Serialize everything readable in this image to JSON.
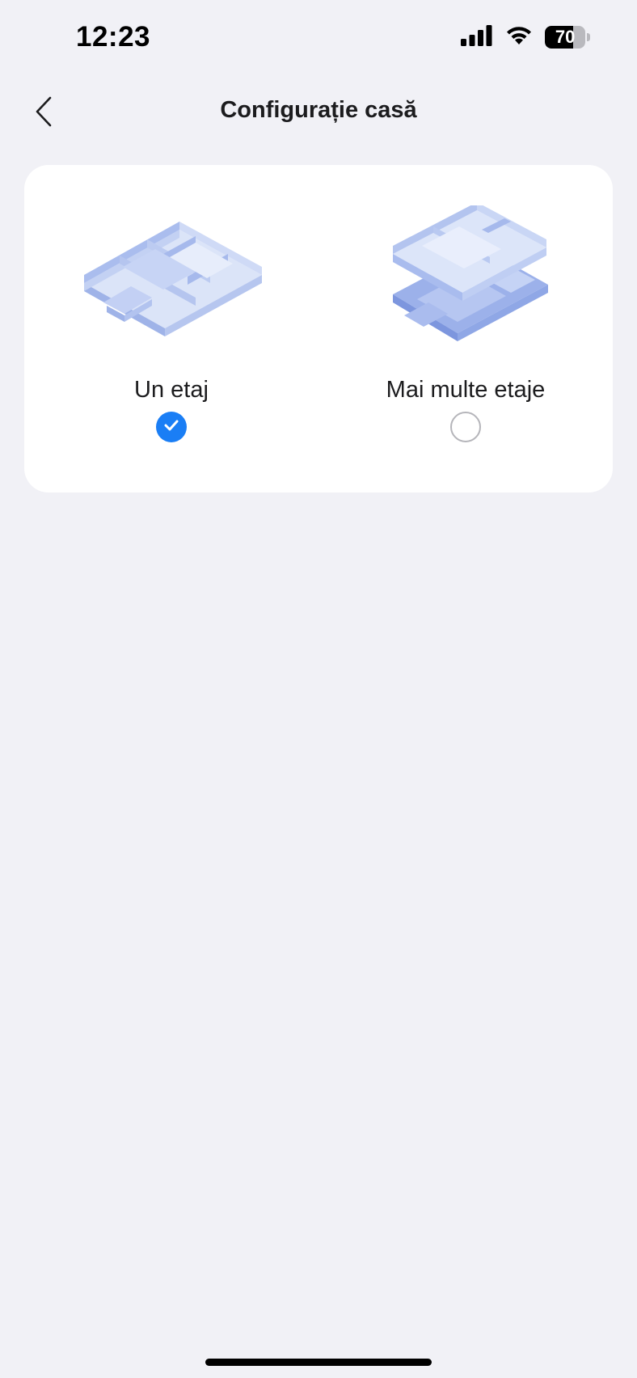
{
  "status_bar": {
    "time": "12:23",
    "battery_level": "70",
    "battery_fraction": 0.7,
    "icons": [
      "cellular-signal-icon",
      "wifi-icon",
      "battery-icon"
    ]
  },
  "nav": {
    "title": "Configurație casă",
    "back_icon": "chevron-left-icon"
  },
  "options": [
    {
      "label": "Un etaj",
      "selected": true,
      "illustration": "single-floor-plan-illustration"
    },
    {
      "label": "Mai multe etaje",
      "selected": false,
      "illustration": "multi-floor-plan-illustration"
    }
  ],
  "colors": {
    "background": "#f1f1f6",
    "card": "#ffffff",
    "accent": "#1a7ef5",
    "illustration_light": "#c9d6f3",
    "illustration_mid": "#a9bcec",
    "illustration_dark": "#7f97dc"
  }
}
